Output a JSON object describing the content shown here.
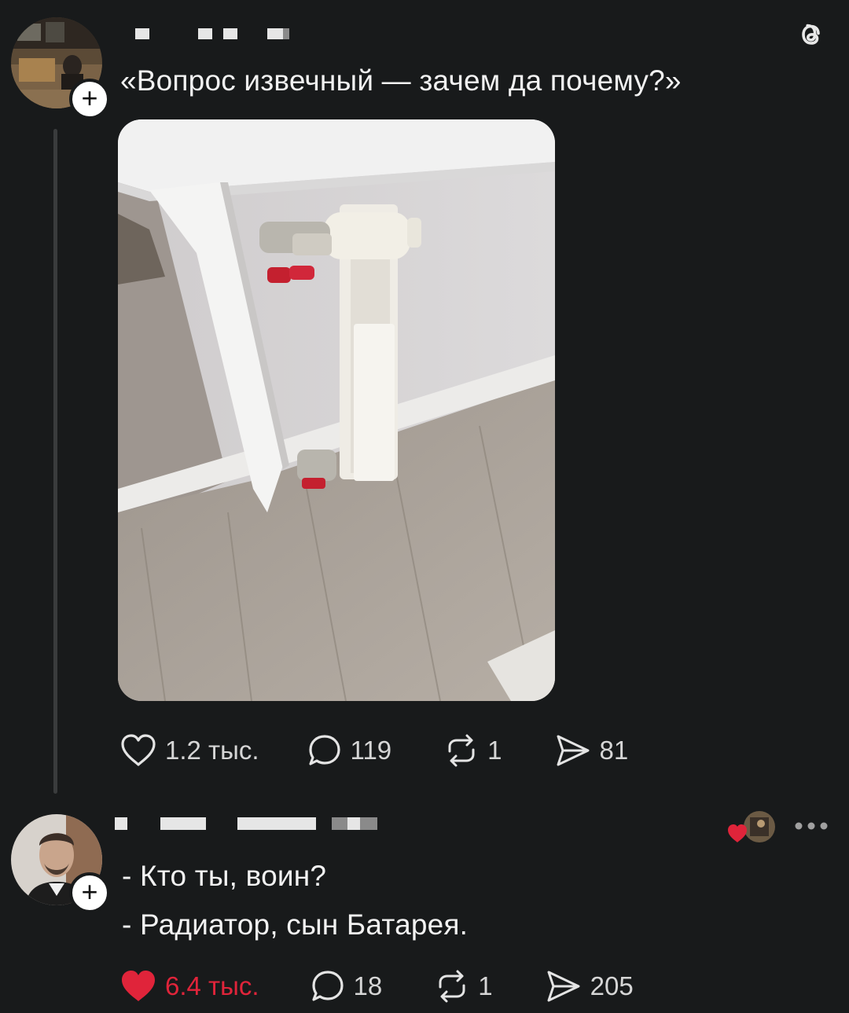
{
  "app": {
    "logo_icon": "threads-logo-icon"
  },
  "post": {
    "text": "«Вопрос извечный — зачем да почему?»",
    "image_icon": "radiator-photo",
    "likes": "1.2 тыс.",
    "replies": "119",
    "reposts": "1",
    "shares": "81"
  },
  "reply": {
    "line1": "- Кто ты, воин?",
    "line2": "- Радиатор, сын Батарея.",
    "likes": "6.4 тыс.",
    "replies": "18",
    "reposts": "1",
    "shares": "205",
    "liked_color": "#e0243a",
    "more_icon": "more-dots-icon"
  }
}
